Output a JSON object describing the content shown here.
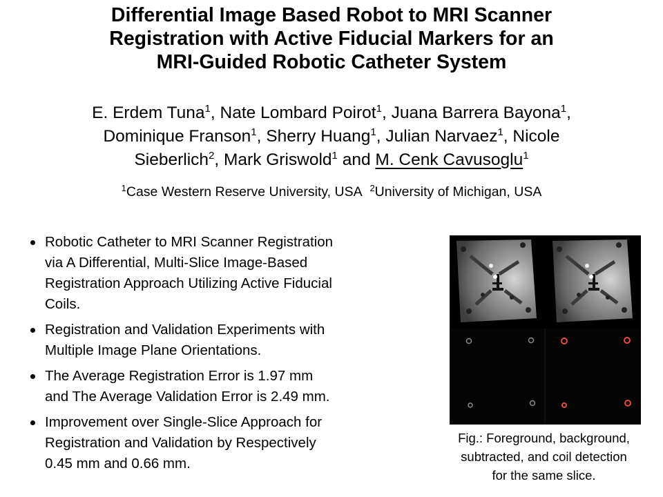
{
  "title": {
    "lines": [
      "Differential Image Based Robot to MRI Scanner",
      "Registration with Active Fiducial Markers for an",
      "MRI-Guided Robotic Catheter System"
    ]
  },
  "authors": {
    "line1": [
      {
        "name": "E. Erdem Tuna",
        "aff": "1"
      },
      {
        "name": "Nate Lombard Poirot",
        "aff": "1"
      },
      {
        "name": "Juana Barrera Bayona",
        "aff": "1"
      }
    ],
    "line2": [
      {
        "name": "Dominique Franson",
        "aff": "1"
      },
      {
        "name": "Sherry Huang",
        "aff": "1"
      },
      {
        "name": "Julian Narvaez",
        "aff": "1"
      },
      {
        "name": "Nicole"
      }
    ],
    "line3": [
      {
        "name": "Sieberlich",
        "aff": "2"
      },
      {
        "name": "Mark Griswold",
        "aff": "1"
      },
      {
        "name": "M. Cenk Cavusoglu",
        "aff": "1"
      }
    ],
    "sep": ",",
    "and": "and"
  },
  "affiliations": [
    {
      "num": "1",
      "name": "Case Western Reserve University, USA"
    },
    {
      "num": "2",
      "name": "University of Michigan, USA"
    }
  ],
  "bullets": [
    [
      "Robotic Catheter to MRI Scanner Registration",
      "via A Differential, Multi-Slice Image-Based",
      "Registration Approach Utilizing Active Fiducial",
      "Coils."
    ],
    [
      "Registration and Validation Experiments with",
      "Multiple Image Plane Orientations."
    ],
    [
      "The Average Registration Error is 1.97 mm",
      "and The Average Validation Error is 2.49 mm."
    ],
    [
      "Improvement over Single-Slice Approach for",
      "Registration and Validation by Respectively",
      "0.45 mm and 0.66 mm."
    ]
  ],
  "figure": {
    "panels": [
      "foreground",
      "background",
      "subtracted",
      "coil-detection"
    ],
    "colors": {
      "background": "#000000",
      "phantom": "#9a9a9a",
      "detection_circle": "#e84c3d"
    }
  },
  "caption": {
    "lines": [
      "Fig.: Foreground, background,",
      "subtracted, and coil detection",
      "for the same slice."
    ]
  }
}
